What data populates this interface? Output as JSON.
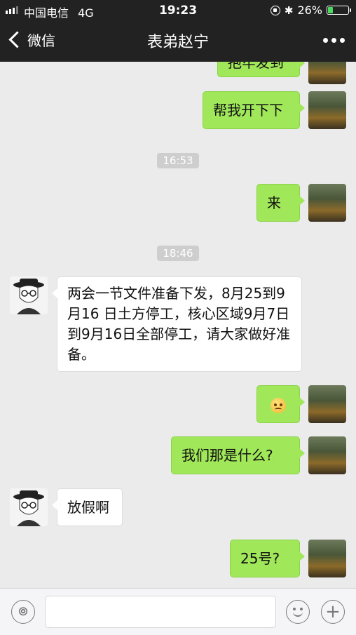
{
  "status_bar": {
    "carrier": "中国电信",
    "network": "4G",
    "time": "19:23",
    "battery_percent": "26%",
    "battery_level": 0.26
  },
  "nav": {
    "back_label": "微信",
    "title": "表弟赵宁",
    "more_icon": "more-dots-icon"
  },
  "messages": [
    {
      "type": "text",
      "side": "right",
      "text": "抱牢发到"
    },
    {
      "type": "text",
      "side": "right",
      "text": "帮我开下下"
    },
    {
      "type": "time",
      "text": "16:53"
    },
    {
      "type": "text",
      "side": "right",
      "text": "来"
    },
    {
      "type": "time",
      "text": "18:46"
    },
    {
      "type": "text",
      "side": "left",
      "text": "两会一节文件准备下发，8月25到9月16 日土方停工，核心区域9月7日到9月16日全部停工，请大家做好准备。"
    },
    {
      "type": "emoji",
      "side": "right",
      "icon": "confused-face-emoji"
    },
    {
      "type": "text",
      "side": "right",
      "text": "我们那是什么?"
    },
    {
      "type": "text",
      "side": "left",
      "text": "放假啊"
    },
    {
      "type": "text",
      "side": "right",
      "text": "25号?"
    }
  ],
  "input_bar": {
    "voice_icon": "voice-icon",
    "emoji_icon": "smile-icon",
    "plus_icon": "plus-icon",
    "input_value": ""
  },
  "colors": {
    "chat_bg": "#ebebeb",
    "sent_bubble": "#a0e75a",
    "received_bubble": "#ffffff",
    "header_bg": "#222222"
  }
}
